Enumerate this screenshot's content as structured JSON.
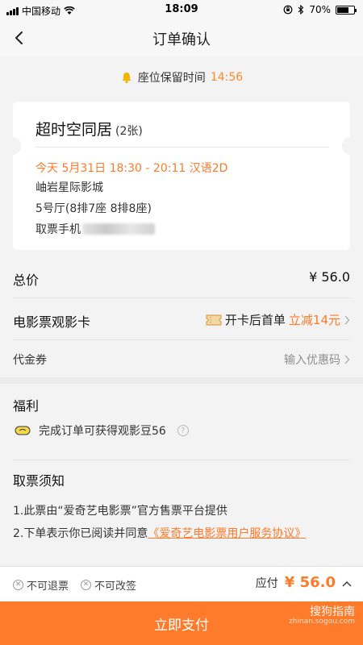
{
  "status_bar": {
    "carrier": "中国移动",
    "time": "18:09",
    "battery": "70%",
    "battery_level": 0.7
  },
  "nav": {
    "title": "订单确认"
  },
  "reserve": {
    "label": "座位保留时间",
    "countdown": "14:56"
  },
  "ticket": {
    "movie_title": "超时空同居",
    "count": "(2张)",
    "showtime": "今天 5月31日 18:30 - 20:11 汉语2D",
    "cinema": "岫岩星际影城",
    "hall_seats": "5号厅(8排7座 8排8座)",
    "phone_label": "取票手机"
  },
  "total": {
    "label": "总价",
    "value": "¥ 56.0"
  },
  "movie_card": {
    "label": "电影票观影卡",
    "promo_prefix": "开卡后首单",
    "promo_highlight": "立减14元"
  },
  "voucher": {
    "label": "代金券",
    "placeholder": "输入优惠码"
  },
  "benefit": {
    "title": "福利",
    "item": "完成订单可获得观影豆56"
  },
  "notice": {
    "title": "取票须知",
    "line1": "1.此票由“爱奇艺电影票”官方售票平台提供",
    "line2_prefix": "2.下单表示你已阅读并同意",
    "line2_link": "《爱奇艺电影票用户服务协议》"
  },
  "bottom": {
    "no_refund": "不可退票",
    "no_change": "不可改签",
    "payable_label": "应付",
    "payable_amount": "¥ 56.0"
  },
  "pay_button": {
    "label": "立即支付"
  },
  "watermark": {
    "title": "搜狗指南",
    "url": "zhinan.sogou.com"
  },
  "colors": {
    "accent": "#ff7b2c",
    "background": "#f3f3f3"
  }
}
